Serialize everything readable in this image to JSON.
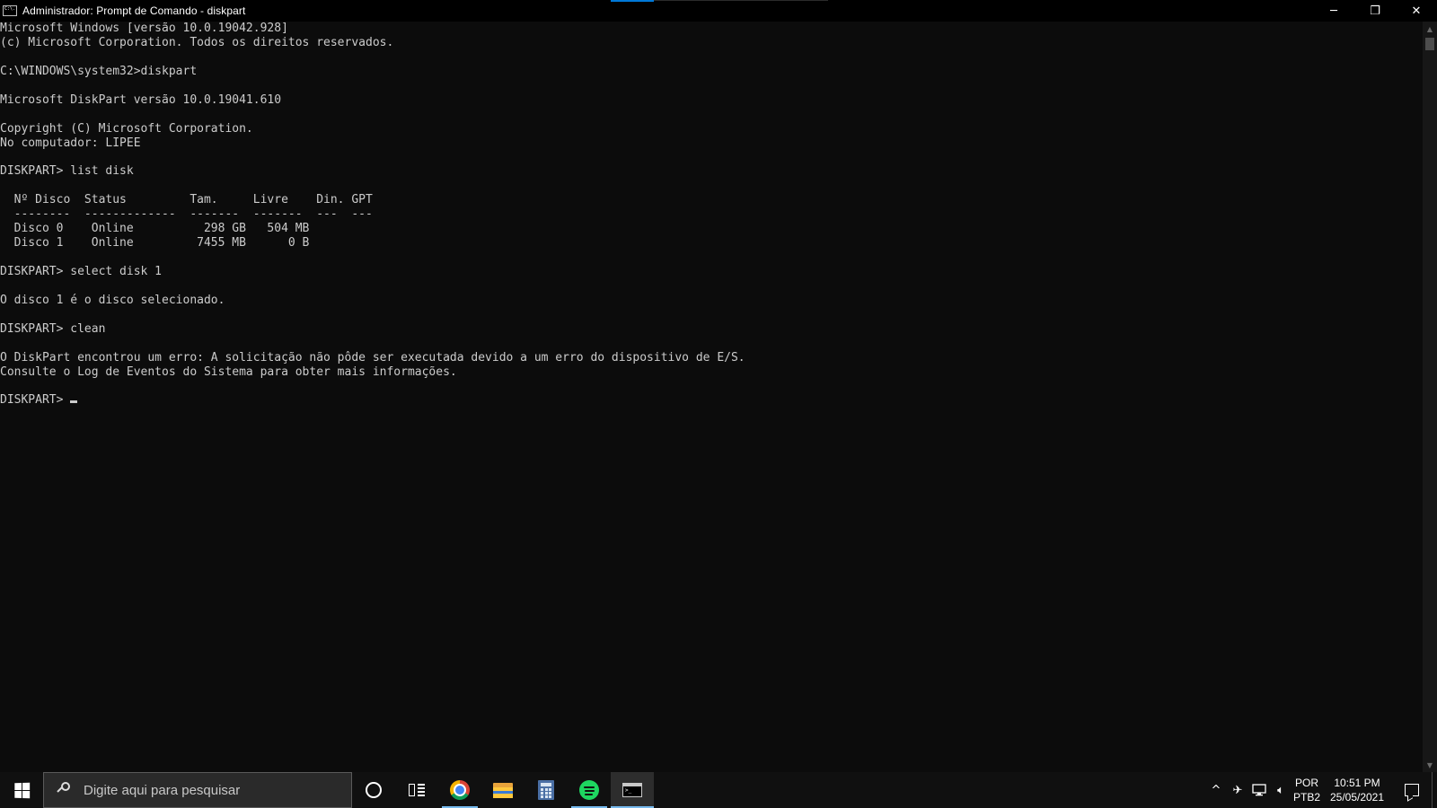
{
  "window": {
    "title": "Administrador: Prompt de Comando - diskpart",
    "app_icon_text": "C:\\.",
    "controls": {
      "minimize": "─",
      "restore": "❐",
      "close": "✕"
    }
  },
  "console": {
    "lines": [
      "Microsoft Windows [versão 10.0.19042.928]",
      "(c) Microsoft Corporation. Todos os direitos reservados.",
      "",
      "C:\\WINDOWS\\system32>diskpart",
      "",
      "Microsoft DiskPart versão 10.0.19041.610",
      "",
      "Copyright (C) Microsoft Corporation.",
      "No computador: LIPEE",
      "",
      "DISKPART> list disk",
      "",
      "  Nº Disco  Status         Tam.     Livre    Din. GPT",
      "  --------  -------------  -------  -------  ---  ---",
      "  Disco 0    Online          298 GB   504 MB",
      "  Disco 1    Online         7455 MB      0 B",
      "",
      "DISKPART> select disk 1",
      "",
      "O disco 1 é o disco selecionado.",
      "",
      "DISKPART> clean",
      "",
      "O DiskPart encontrou um erro: A solicitação não pôde ser executada devido a um erro do dispositivo de E/S.",
      "Consulte o Log de Eventos do Sistema para obter mais informações.",
      ""
    ],
    "prompt": "DISKPART> "
  },
  "taskbar": {
    "search_placeholder": "Digite aqui para pesquisar",
    "apps": [
      {
        "name": "chrome-icon"
      },
      {
        "name": "file-explorer-icon"
      },
      {
        "name": "calculator-icon"
      },
      {
        "name": "spotify-icon"
      },
      {
        "name": "command-prompt-icon"
      }
    ],
    "tray": {
      "chevron": "^",
      "language_line1": "POR",
      "language_line2": "PTB2",
      "time": "10:51 PM",
      "date": "25/05/2021"
    }
  },
  "colors": {
    "console_bg": "#0c0c0c",
    "console_fg": "#cccccc",
    "taskbar_bg": "#101010",
    "accent": "#76b9ed"
  }
}
